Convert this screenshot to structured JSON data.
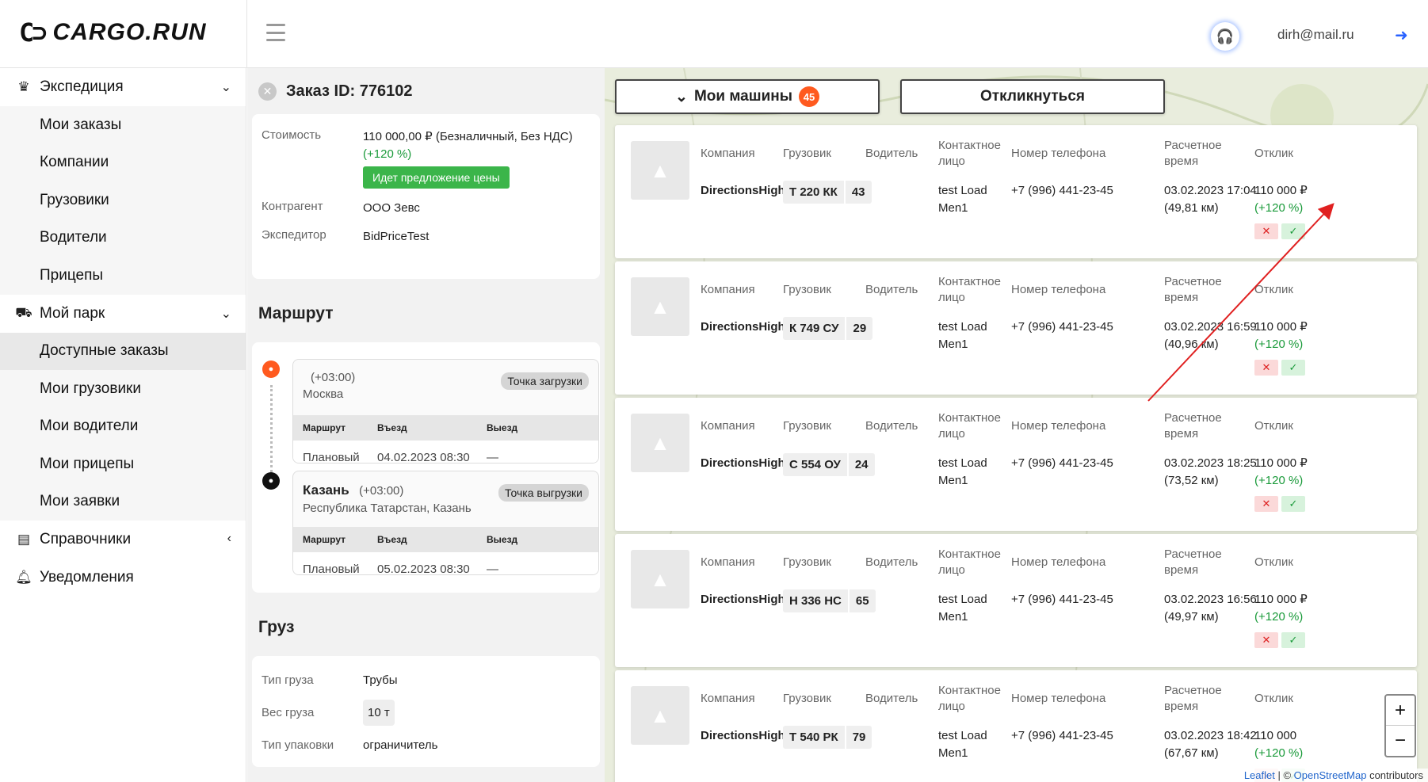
{
  "header": {
    "logo_mark": "C⊃",
    "logo_text": "CARGO.RUN",
    "user_email": "dirh@mail.ru"
  },
  "sidebar": {
    "expedition": "Экспедиция",
    "exp_items": [
      "Мои заказы",
      "Компании",
      "Грузовики",
      "Водители",
      "Прицепы"
    ],
    "park": "Мой парк",
    "park_items": [
      "Доступные заказы",
      "Мои грузовики",
      "Мои водители",
      "Мои прицепы",
      "Мои заявки"
    ],
    "refs": "Справочники",
    "notify": "Уведомления"
  },
  "order": {
    "title": "Заказ ID: 776102",
    "cost_label": "Стоимость",
    "cost_value": "110 000,00 ₽ (Безналичный, Без НДС)",
    "cost_pct": "(+120 %)",
    "price_badge": "Идет предложение цены",
    "contr_label": "Контрагент",
    "contr_value": "ООО Зевс",
    "exp_label": "Экспедитор",
    "exp_value": "BidPriceTest"
  },
  "route": {
    "title": "Маршрут",
    "head": {
      "c1": "Маршрут",
      "c2": "Въезд",
      "c3": "Выезд"
    },
    "points": [
      {
        "tz": "(+03:00)",
        "city": "",
        "addr": "Москва",
        "tag": "Точка загрузки",
        "row_label": "Плановый",
        "in": "04.02.2023 08:30",
        "out": "—"
      },
      {
        "tz": "(+03:00)",
        "city": "Казань",
        "addr": "Республика Татарстан, Казань",
        "tag": "Точка выгрузки",
        "row_label": "Плановый",
        "in": "05.02.2023 08:30",
        "out": "—"
      }
    ]
  },
  "cargo": {
    "title": "Груз",
    "type_label": "Тип груза",
    "type_value": "Трубы",
    "weight_label": "Вес груза",
    "weight_value": "10 т",
    "pack_label": "Тип упаковки",
    "pack_value": "ограничитель"
  },
  "map": {
    "my_trucks": "Мои машины",
    "my_trucks_count": "45",
    "respond": "Откликнуться",
    "attrib_leaflet": "Leaflet",
    "attrib_sep": " | © ",
    "attrib_osm": "OpenStreetMap",
    "attrib_tail": " contributors"
  },
  "cols": {
    "company": "Компания",
    "truck": "Грузовик",
    "driver": "Водитель",
    "contact": "Контактное лицо",
    "phone": "Номер телефона",
    "eta": "Расчетное время",
    "resp": "Отклик"
  },
  "responses": [
    {
      "company": "DirectionsHight",
      "plate": "Т 220 КК",
      "region": "43",
      "contact": "test Load Men1",
      "phone": "+7 (996) 441-23-45",
      "eta": "03.02.2023 17:04",
      "dist": "(49,81 км)",
      "price": "110 000 ₽",
      "pct": "(+120 %)"
    },
    {
      "company": "DirectionsHight",
      "plate": "К 749 СУ",
      "region": "29",
      "contact": "test Load Men1",
      "phone": "+7 (996) 441-23-45",
      "eta": "03.02.2023 16:59",
      "dist": "(40,96 км)",
      "price": "110 000 ₽",
      "pct": "(+120 %)"
    },
    {
      "company": "DirectionsHight",
      "plate": "С 554 ОУ",
      "region": "24",
      "contact": "test Load Men1",
      "phone": "+7 (996) 441-23-45",
      "eta": "03.02.2023 18:25",
      "dist": "(73,52 км)",
      "price": "110 000 ₽",
      "pct": "(+120 %)"
    },
    {
      "company": "DirectionsHight",
      "plate": "Н 336 НС",
      "region": "65",
      "contact": "test Load Men1",
      "phone": "+7 (996) 441-23-45",
      "eta": "03.02.2023 16:56",
      "dist": "(49,97 км)",
      "price": "110 000 ₽",
      "pct": "(+120 %)"
    },
    {
      "company": "DirectionsHight",
      "plate": "Т 540 РК",
      "region": "79",
      "contact": "test Load Men1",
      "phone": "+7 (996) 441-23-45",
      "eta": "03.02.2023 18:42",
      "dist": "(67,67 км)",
      "price": "110 000",
      "pct": "(+120 %)"
    }
  ],
  "colors": {
    "accent_green": "#3bb54a",
    "badge_orange": "#ff5a1f",
    "arrow_red": "#e02020",
    "link_blue": "#2962ff"
  }
}
